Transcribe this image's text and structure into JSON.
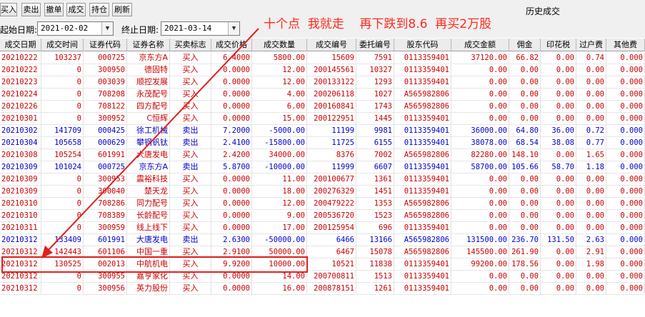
{
  "window": {
    "title": "历史成交"
  },
  "toolbar": {
    "buttons": [
      "买入",
      "卖出",
      "撤单",
      "成交",
      "持仓",
      "刷新"
    ]
  },
  "filter": {
    "start_label": "起始日期:",
    "start_value": "2021-02-02",
    "end_label": "终止日期:",
    "end_value": "2021-03-14"
  },
  "annotation": {
    "text": "十个点  我就走    再下跌到8.6  再买2万股",
    "color": "#ff2a1e"
  },
  "colors": {
    "buy": "#cc0000",
    "sell": "#0000cc",
    "highlight": "#e0211e"
  },
  "table": {
    "columns": [
      "成交日期",
      "成交时间",
      "证券代码",
      "证券名称",
      "买卖标志",
      "成交价格",
      "成交数量",
      "成交编号",
      "委托编号",
      "股东代码",
      "成交金额",
      "佣金",
      "印花税",
      "过户费",
      "其他费"
    ],
    "rows": [
      [
        "20210222",
        "103237",
        "000725",
        "京东方A",
        "买入",
        "6.4000",
        "5800.00",
        "15609",
        "7591",
        "0113359401",
        "37120.00",
        "66.82",
        "0.00",
        "0.74",
        "0.000"
      ],
      [
        "20210222",
        "0",
        "300950",
        "德固特",
        "买入",
        "0.0000",
        "12.00",
        "200145561",
        "10327",
        "0113359401",
        "0.00",
        "0.00",
        "0.00",
        "0.00",
        "0.000"
      ],
      [
        "20210223",
        "0",
        "003039",
        "顺控发展",
        "买入",
        "0.0000",
        "12.00",
        "200133122",
        "1293",
        "0113359401",
        "0.00",
        "0.00",
        "0.00",
        "0.00",
        "0.000"
      ],
      [
        "20210224",
        "0",
        "708208",
        "永茂配号",
        "买入",
        "0.0000",
        "4.00",
        "200206118",
        "1027",
        "A565982806",
        "0.00",
        "0.00",
        "0.00",
        "0.00",
        "0.000"
      ],
      [
        "20210226",
        "0",
        "708122",
        "四方配号",
        "买入",
        "0.0000",
        "6.00",
        "200160841",
        "1743",
        "A565982806",
        "0.00",
        "0.00",
        "0.00",
        "0.00",
        "0.000"
      ],
      [
        "20210301",
        "0",
        "300952",
        "C恒辉",
        "买入",
        "0.0000",
        "15.00",
        "200122951",
        "1445",
        "0113359401",
        "0.00",
        "0.00",
        "0.00",
        "0.00",
        "0.000"
      ],
      [
        "20210302",
        "141709",
        "000425",
        "徐工机械",
        "卖出",
        "7.2000",
        "-5000.00",
        "11199",
        "9981",
        "0113359401",
        "36000.00",
        "64.80",
        "36.00",
        "0.72",
        "0.000"
      ],
      [
        "20210304",
        "105658",
        "000629",
        "攀钢钒钛",
        "卖出",
        "2.4100",
        "-15800.00",
        "11725",
        "6155",
        "0113359401",
        "38078.00",
        "68.54",
        "38.08",
        "0.77",
        "0.000"
      ],
      [
        "20210308",
        "105254",
        "601991",
        "大唐发电",
        "买入",
        "2.4200",
        "34000.00",
        "8376",
        "7002",
        "A565982806",
        "82280.00",
        "148.10",
        "0.00",
        "1.65",
        "0.000"
      ],
      [
        "20210309",
        "101024",
        "000725",
        "京东方A",
        "卖出",
        "5.8700",
        "-10000.00",
        "11999",
        "6607",
        "0113359401",
        "58700.00",
        "105.66",
        "58.70",
        "1.18",
        "0.000"
      ],
      [
        "20210309",
        "0",
        "300953",
        "震裕科技",
        "买入",
        "0.0000",
        "11.00",
        "200100677",
        "1361",
        "0113359401",
        "0.00",
        "0.00",
        "0.00",
        "0.00",
        "0.000"
      ],
      [
        "20210309",
        "0",
        "300040",
        "楚天龙",
        "买入",
        "0.0000",
        "18.00",
        "200276329",
        "1451",
        "0113359401",
        "0.00",
        "0.00",
        "0.00",
        "0.00",
        "0.000"
      ],
      [
        "20210310",
        "0",
        "708286",
        "同力配号",
        "买入",
        "0.0000",
        "12.00",
        "200479222",
        "1353",
        "A565982806",
        "0.00",
        "0.00",
        "0.00",
        "0.00",
        "0.000"
      ],
      [
        "20210310",
        "0",
        "708389",
        "长龄配号",
        "买入",
        "0.0000",
        "9.00",
        "200536720",
        "1523",
        "A565982806",
        "0.00",
        "0.00",
        "0.00",
        "0.00",
        "0.000"
      ],
      [
        "20210311",
        "0",
        "300959",
        "线上线下",
        "买入",
        "0.0000",
        "17.00",
        "200125954",
        "696",
        "0113359401",
        "0.00",
        "0.00",
        "0.00",
        "0.00",
        "0.000"
      ],
      [
        "20210312",
        "133409",
        "601991",
        "大唐发电",
        "卖出",
        "2.6300",
        "-50000.00",
        "6466",
        "13166",
        "A565982806",
        "131500.00",
        "236.70",
        "131.50",
        "2.63",
        "0.000"
      ],
      [
        "20210312",
        "142443",
        "601106",
        "中国一重",
        "买入",
        "2.9100",
        "50000.00",
        "6467",
        "15078",
        "A565982806",
        "145500.00",
        "261.90",
        "0.00",
        "2.91",
        "0.000"
      ],
      [
        "20210312",
        "130525",
        "002013",
        "中航机电",
        "买入",
        "9.9200",
        "10000.00",
        "10521",
        "11838",
        "0113359401",
        "99200.00",
        "178.56",
        "0.00",
        "1.98",
        "0.000"
      ],
      [
        "20210312",
        "0",
        "300955",
        "嘉亨家化",
        "买入",
        "0.0000",
        "14.00",
        "200700811",
        "1513",
        "0113359401",
        "0.00",
        "0.00",
        "0.00",
        "0.00",
        "0.000"
      ],
      [
        "20210312",
        "0",
        "300956",
        "英力股份",
        "买入",
        "0.0000",
        "16.00",
        "200878151",
        "1261",
        "0113359401",
        "0.00",
        "0.00",
        "0.00",
        "0.00",
        "0.000"
      ]
    ],
    "highlighted_row": 17
  }
}
